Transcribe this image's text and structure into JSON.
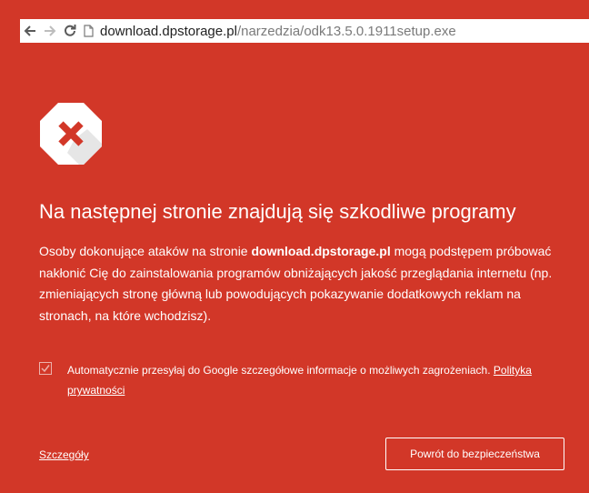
{
  "browser": {
    "url_host": "download.dpstorage.pl",
    "url_path": "/narzedzia/odk13.5.0.1911setup.exe",
    "back_icon": "arrow-left-icon",
    "forward_icon": "arrow-right-icon",
    "reload_icon": "reload-icon",
    "page_icon": "page-icon"
  },
  "warning": {
    "icon": "danger-x-icon",
    "title": "Na następnej stronie znajdują się szkodliwe programy",
    "description_before": "Osoby dokonujące ataków na stronie ",
    "description_host": "download.dpstorage.pl",
    "description_after": " mogą podstępem próbować nakłonić Cię do zainstalowania programów obniżających jakość przeglądania internetu (np. zmieniających stronę główną lub powodujących pokazywanie dodatkowych reklam na stronach, na które wchodzisz).",
    "checkbox_label": "Automatycznie przesyłaj do Google szczegółowe informacje o możliwych zagrożeniach.",
    "privacy_link": "Polityka prywatności",
    "checkbox_checked": true,
    "details_link": "Szczegóły",
    "back_button": "Powrót do bezpieczeństwa"
  },
  "colors": {
    "background": "#d23728",
    "text": "#ffffff",
    "icon_x": "#d23728"
  }
}
